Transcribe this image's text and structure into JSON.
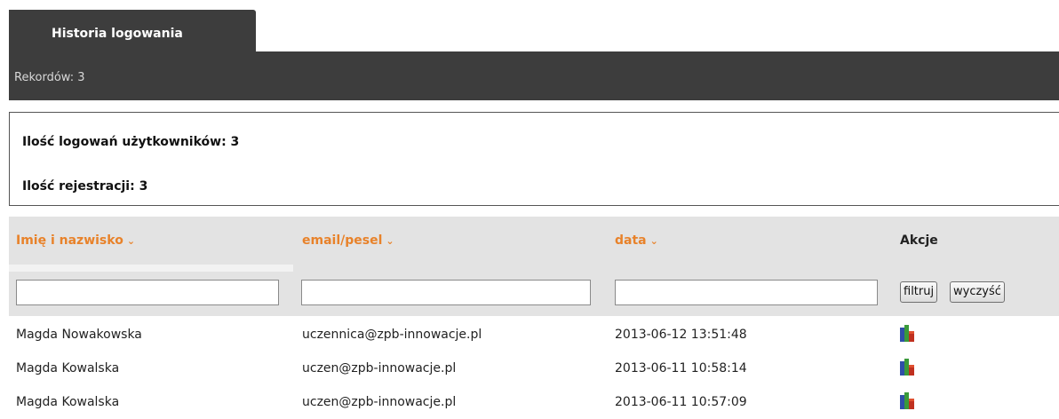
{
  "tab": {
    "label": "Historia logowania"
  },
  "bar": {
    "records": "Rekordów: 3"
  },
  "stats": {
    "logins": "Ilość logowań użytkowników: 3",
    "registrations": "Ilość rejestracji: 3"
  },
  "table": {
    "columns": [
      {
        "label": "Imię i nazwisko",
        "sortable": true
      },
      {
        "label": "email/pesel",
        "sortable": true
      },
      {
        "label": "data",
        "sortable": true
      },
      {
        "label": "Akcje",
        "sortable": false
      }
    ],
    "sort_icon": "chevron-down-icon",
    "filters": {
      "name_value": "",
      "email_value": "",
      "date_value": "",
      "filter_button": "filtruj",
      "clear_button": "wyczyść"
    },
    "rows": [
      {
        "name": "Magda Nowakowska",
        "email": "uczennica@zpb-innowacje.pl",
        "date": "2013-06-12 13:51:48",
        "action_icon": "bar-chart-icon"
      },
      {
        "name": "Magda Kowalska",
        "email": "uczen@zpb-innowacje.pl",
        "date": "2013-06-11 10:58:14",
        "action_icon": "bar-chart-icon"
      },
      {
        "name": "Magda Kowalska",
        "email": "uczen@zpb-innowacje.pl",
        "date": "2013-06-11 10:57:09",
        "action_icon": "bar-chart-icon"
      }
    ]
  },
  "colors": {
    "dark_bar": "#3d3d3d",
    "accent_orange": "#e8822a",
    "header_bg": "#e3e3e3"
  }
}
